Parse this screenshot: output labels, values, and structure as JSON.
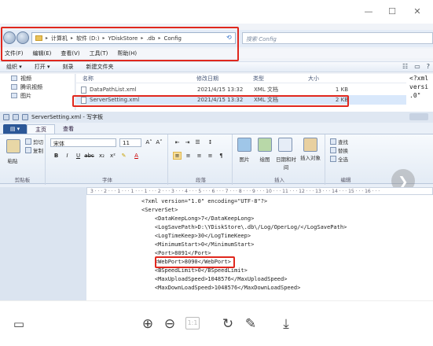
{
  "explorer": {
    "address_segments": [
      "计算机",
      "软件 (D:)",
      "YDiskStore",
      ".db",
      "Config"
    ],
    "search_placeholder": "搜索 Config",
    "menu": [
      "文件(F)",
      "编辑(E)",
      "查看(V)",
      "工具(T)",
      "帮助(H)"
    ],
    "toolbar": [
      "组织 ▾",
      "打开 ▾",
      "刻录",
      "新建文件夹"
    ],
    "sidebar": [
      "视频",
      "腾讯视频",
      "图片"
    ],
    "columns": [
      "名称",
      "修改日期",
      "类型",
      "大小"
    ],
    "files": [
      {
        "name": "DataPathList.xml",
        "date": "2021/4/15 13:32",
        "type": "XML 文档",
        "size": "1 KB"
      },
      {
        "name": "ServerSetting.xml",
        "date": "2021/4/15 13:32",
        "type": "XML 文档",
        "size": "2 KB"
      }
    ],
    "preview": [
      "<?xml",
      "versi",
      ".0\""
    ]
  },
  "wordpad": {
    "title": "ServerSetting.xml - 写字板",
    "tabs": [
      "主页",
      "查看"
    ],
    "clipboard": {
      "paste": "粘贴",
      "cut": "剪切",
      "copy": "复制",
      "label": "剪贴板"
    },
    "font": {
      "name": "宋体",
      "size": "11",
      "label": "字体"
    },
    "paragraph_label": "段落",
    "insert": {
      "picture": "图片",
      "paint": "绘图",
      "datetime": "日期和时间",
      "object": "插入对象",
      "label": "插入"
    },
    "edit": {
      "find": "查找",
      "replace": "替换",
      "select_all": "全选",
      "label": "编辑"
    },
    "ruler": "3 · · · 2 · · · 1 · · · 1 · · · 1 · · · 2 · · · 3 · · · 4 · · · 5 · · · 6 · · · 7 · · · 8 · · · 9 · · · 10 · · · 11 · · · 12 · · · 13 · · · 14 · · · 15 · · · 16 · · ·",
    "doc_lines": [
      "<?xml version=\"1.0\" encoding=\"UTF-8\"?>",
      "<ServerSet>",
      "    <DataKeepLong>7</DataKeepLong>",
      "    <LogSavePath>D:\\YDiskStore\\.db\\/Log/OperLog/</LogSavePath>",
      "    <LogTimeKeep>30</LogTimeKeep>",
      "    <MinimumStart>0</MinimumStart>",
      "    <Port>8091</Port>",
      "    <WebPort>8090</WebPort>",
      "    <BSpeedLimit>0</BSpeedLimit>",
      "    <MaxUploadSpeed>1048576</MaxUploadSpeed>",
      "    <MaxDownLoadSpeed>1048576</MaxDownLoadSpeed>"
    ]
  },
  "viewer": {
    "page_number": "1:1"
  }
}
